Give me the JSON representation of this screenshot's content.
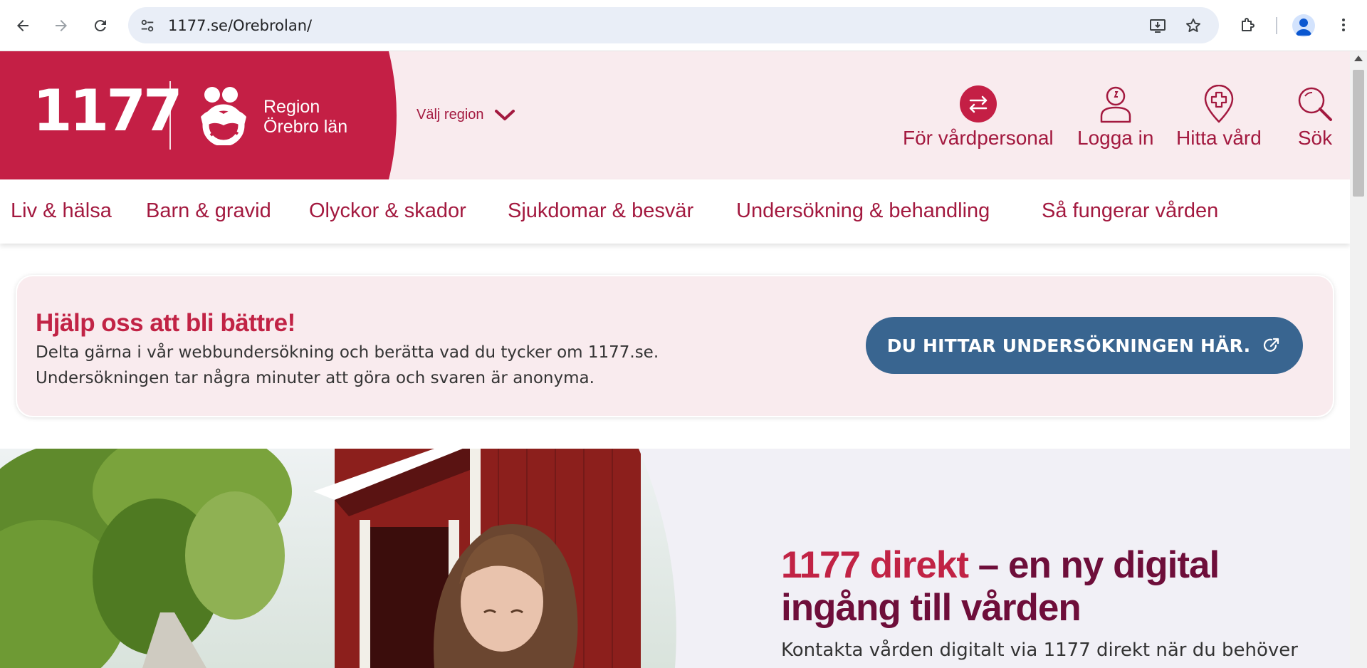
{
  "browser": {
    "url": "1177.se/Orebrolan/",
    "back_icon": "arrow-left-icon",
    "forward_icon": "arrow-right-icon",
    "reload_icon": "reload-icon",
    "site_info_icon": "tune-icon",
    "install_icon": "install-app-icon",
    "bookmark_icon": "star-icon",
    "extensions_icon": "puzzle-icon",
    "profile_icon": "person-icon",
    "menu_icon": "more-vertical-icon"
  },
  "header": {
    "logo_text": "1177",
    "region_line1": "Region",
    "region_line2": "Örebro län",
    "region_selector": "Välj region",
    "links": [
      {
        "label": "För vårdpersonal",
        "icon": "swap-arrows-icon"
      },
      {
        "label": "Logga in",
        "icon": "user-icon"
      },
      {
        "label": "Hitta vård",
        "icon": "location-plus-icon"
      },
      {
        "label": "Sök",
        "icon": "search-icon"
      }
    ],
    "colors": {
      "brand": "#c41f45",
      "link": "#a3193f",
      "header_bg": "#f9ebee"
    }
  },
  "nav": {
    "items": [
      "Liv & hälsa",
      "Barn & gravid",
      "Olyckor & skador",
      "Sjukdomar & besvär",
      "Undersökning & behandling",
      "Så fungerar vården"
    ]
  },
  "survey": {
    "title": "Hjälp oss att bli bättre!",
    "text_line1": "Delta gärna i vår webbundersökning och berätta vad du tycker om 1177.se.",
    "text_line2": "Undersökningen tar några minuter att göra och svaren är anonyma.",
    "button_label": "DU HITTAR UNDERSÖKNINGEN HÄR.",
    "button_icon": "external-link-icon",
    "button_color": "#396590"
  },
  "hero": {
    "title_highlight": "1177 direkt",
    "title_rest": " – en ny digital ingång till vården",
    "text": "Kontakta vården digitalt via 1177 direkt när du behöver"
  }
}
